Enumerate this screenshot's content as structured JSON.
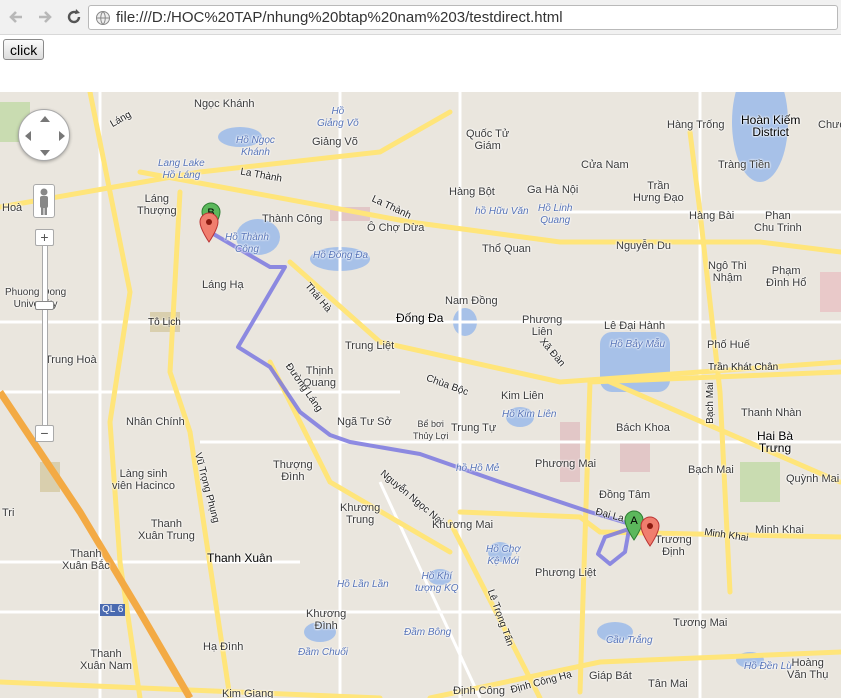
{
  "browser": {
    "url": "file:///D:/HOC%20TAP/nhung%20btap%20nam%203/testdirect.html",
    "back_icon": "arrow-left-icon",
    "forward_icon": "arrow-right-icon",
    "reload_icon": "reload-icon"
  },
  "page": {
    "click_label": "click"
  },
  "map": {
    "markers": [
      {
        "label": "B",
        "color": "#5cb85c"
      },
      {
        "label": "A",
        "color": "#5cb85c"
      }
    ],
    "route_color": "#7b78e0",
    "labels": {
      "ngoc_khanh": "Ngọc Khánh",
      "ho_giang_vo": "Hồ\nGiảng Võ",
      "giang_vo": "Giảng Võ",
      "quoc_tu_giam": "Quốc Tử\nGiám",
      "hang_trong": "Hàng Trống",
      "hoan_kiem": "Hoàn Kiếm\nDistrict",
      "chuong": "Chươ",
      "lang": "Láng",
      "ho_ngoc_khanh": "Hồ Ngọc\nKhánh",
      "cua_nam": "Cửa Nam",
      "trang_tien": "Tràng Tiền",
      "lang_lake": "Lang Lake\nHồ Láng",
      "la_thanh": "La Thành",
      "hang_bot": "Hàng Bột",
      "ga_ha_noi": "Ga Hà Nội",
      "tran_hung_dao": "Trần\nHưng Đạo",
      "lang_thuong": "Láng\nThượng",
      "thanh_cong": "Thành Công",
      "la_thanh2": "La Thành",
      "ho_huu_van": "hồ Hữu Văn",
      "ho_linh_quang": "Hồ Linh\nQuang",
      "hang_bai": "Hàng Bài",
      "phan_chu_trinh": "Phan\nChu Trinh",
      "hoa": "Hoà",
      "ho_thanh_cong": "Hồ Thành\nCông",
      "o_cho_dua": "Ô Chợ Dừa",
      "tho_quan": "Thổ Quan",
      "nguyen_du": "Nguyễn Du",
      "ngo_thi_nham": "Ngô Thì\nNhậm",
      "pham_dinh_ho": "Phạm\nĐình Hổ",
      "lang_ha": "Láng Hạ",
      "ho_dong_da": "Hồ Đống Đa",
      "phuong_dong": "Phuong Dong\nUniversity",
      "nam_dong": "Nam Đồng",
      "dong_da": "Đống Đa",
      "phuong_lien": "Phương\nLiên",
      "le_dai_hanh": "Lê Đại Hành",
      "ho_bay_mau": "Hồ Bảy Mẫu",
      "to_lich": "Tô Lịch",
      "thai_ha": "Thái Hà",
      "trung_liet": "Trung Liệt",
      "pho_hue": "Phố Huế",
      "trung_hoa": "Trung Hoà",
      "xa_dan": "Xã Đàn",
      "tran_khat_chan": "Trần Khát Chân",
      "thinh_quang": "Thịnh\nQuang",
      "chua_boc": "Chùa Bộc",
      "kim_lien": "Kim Liên",
      "ho_kim_lien": "Hồ Kim Liên",
      "duong_lang": "Đường Láng",
      "bach_mai_road": "Bạch Mai",
      "thanh_nhan": "Thanh Nhàn",
      "nhan_chinh": "Nhân Chính",
      "nga_tu_so": "Ngã Tư Sở",
      "be_boi": "Bể bơi\nThủy Lợi",
      "trung_tu": "Trung Tự",
      "bach_khoa": "Bách Khoa",
      "hai_ba_trung": "Hai Bà\nTrưng",
      "lang_sinh": "Làng sinh\nviên Hacinco",
      "vu_trong_phung": "Vũ Trọng Phụng",
      "thuong_dinh": "Thượng\nĐình",
      "ho_ho_me": "hồ Hồ Mẻ",
      "phuong_mai": "Phương Mai",
      "bach_mai": "Bạch Mai",
      "quynh_mai": "Quỳnh Mai",
      "nguyen_ngoc_nai": "Nguyễn Ngọc Nại",
      "dong_tam": "Đồng Tâm",
      "dai_la": "Đại La",
      "minh_khai_road": "Minh Khai",
      "minh_khai": "Minh Khai",
      "thanh_xuan_trung": "Thanh\nXuân Trung",
      "khuong_trung": "Khương\nTrung",
      "khuong_mai": "Khương Mai",
      "truong_dinh": "Trương\nĐịnh",
      "tri": "Tri",
      "thanh_xuan_bac": "Thanh\nXuân Bắc",
      "thanh_xuan": "Thanh Xuân",
      "ho_cho_ke_moi": "Hồ Chợ\nKệ Mới",
      "phuong_liet": "Phương Liệt",
      "ho_lan_lan": "Hồ Lần Lần",
      "ho_khi_tuong": "Hồ Khí\ntượng KQ",
      "ql6": "QL 6",
      "khuong_dinh": "Khương\nĐình",
      "le_trong_tan": "Lê Trọng Tấn",
      "dam_bong": "Đầm Bông",
      "tuong_mai": "Tương Mai",
      "cau_trang": "Cầu Trắng",
      "ha_dinh": "Hạ Đình",
      "dam_chuoi": "Đầm Chuối",
      "giap_bat": "Giáp Bát",
      "ho_den_lu": "Hồ Đền Lừ",
      "thanh_xuan_nam": "Thanh\nXuân Nam",
      "dinh_cong_ha": "Định Công Hạ",
      "hoang_van_thu": "Hoàng\nVăn Thụ",
      "kim_giang": "Kim Giang",
      "dinh_cong": "Định Công",
      "tan_mai": "Tân Mai"
    }
  }
}
